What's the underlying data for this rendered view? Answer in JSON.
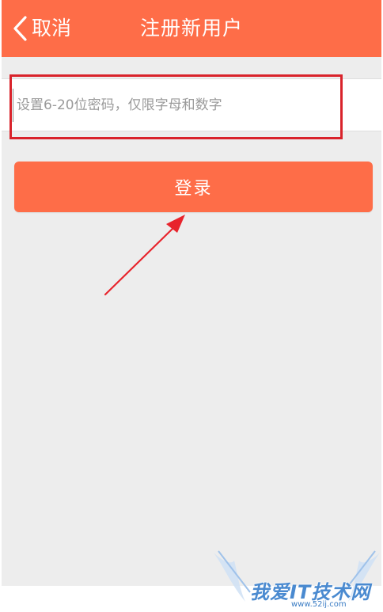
{
  "header": {
    "back_label": "取消",
    "title": "注册新用户"
  },
  "form": {
    "password_placeholder": "设置6-20位密码，仅限字母和数字",
    "password_value": ""
  },
  "actions": {
    "login_label": "登录"
  },
  "watermark": {
    "text": "我爱IT技术网",
    "url": "www.52ij.com"
  },
  "colors": {
    "brand": "#fe6d48",
    "background": "#ededed",
    "annotation": "#d9232b",
    "watermark": "#4a8ad0"
  },
  "icons": {
    "back": "chevron-left-icon"
  }
}
